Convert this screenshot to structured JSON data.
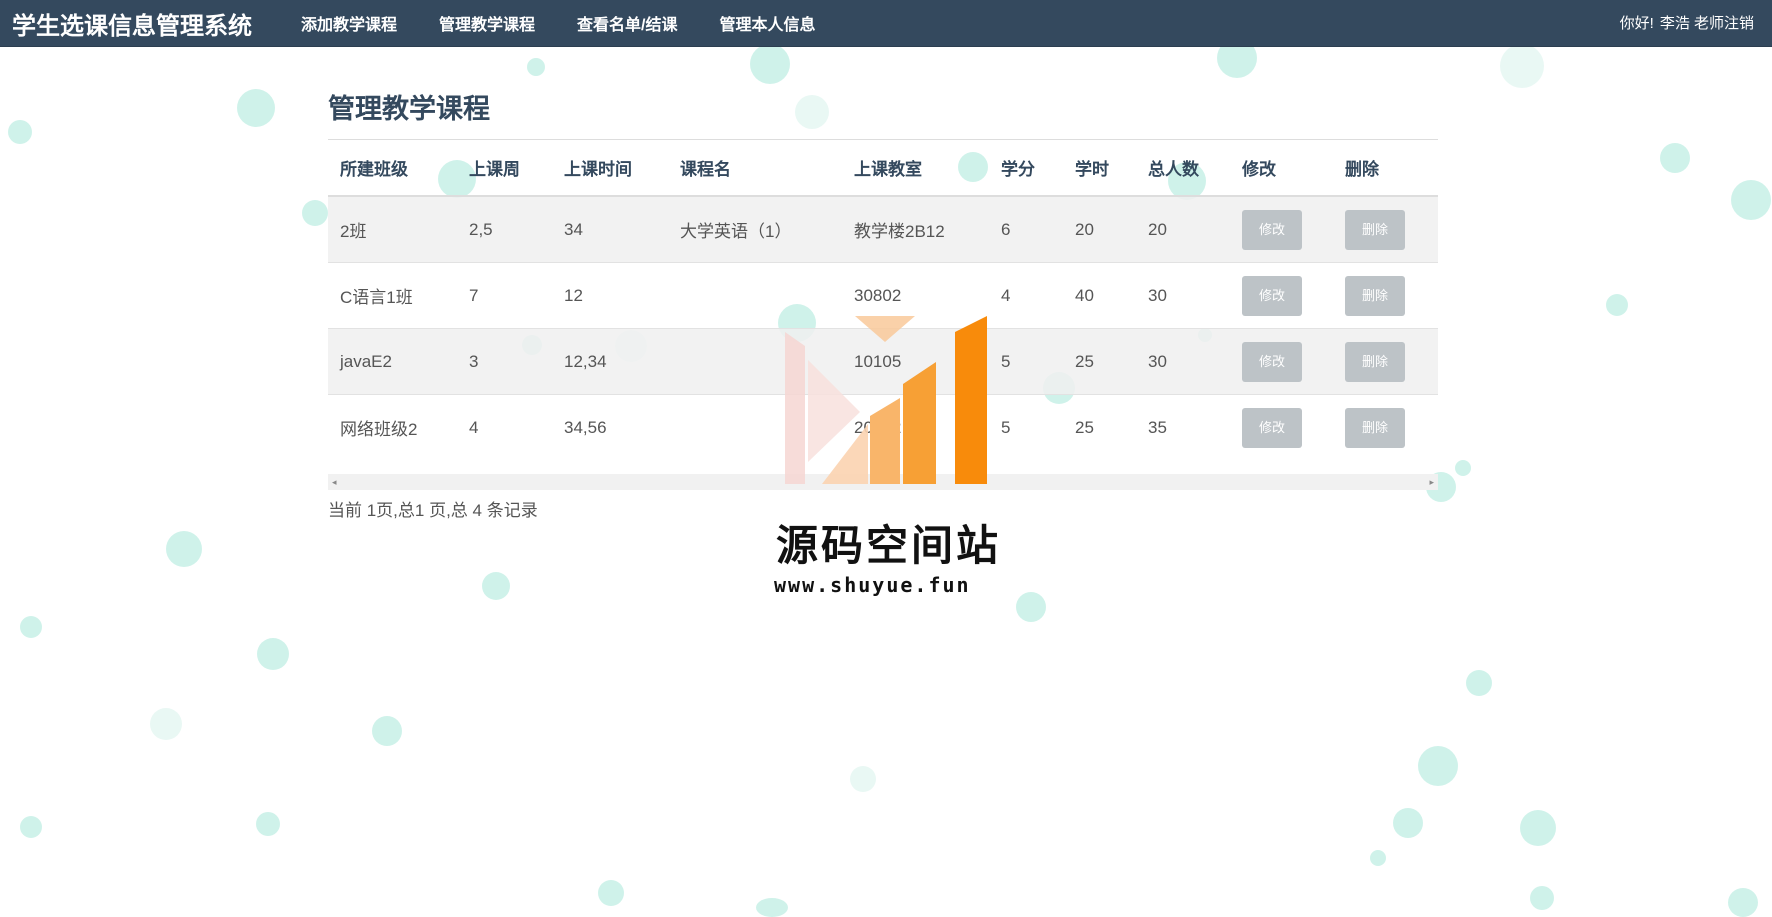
{
  "navbar": {
    "brand": "学生选课信息管理系统",
    "links": [
      "添加教学课程",
      "管理教学课程",
      "查看名单/结课",
      "管理本人信息"
    ],
    "greeting": "你好!",
    "user": "李浩 老师",
    "logout": "注销"
  },
  "page": {
    "title": "管理教学课程"
  },
  "table": {
    "headers": [
      "所建班级",
      "上课周",
      "上课时间",
      "课程名",
      "上课教室",
      "学分",
      "学时",
      "总人数",
      "修改",
      "删除"
    ],
    "rows": [
      [
        "2班",
        "2,5",
        "34",
        "大学英语（1）",
        "教学楼2B12",
        "6",
        "20",
        "20"
      ],
      [
        "C语言1班",
        "7",
        "12",
        "",
        "30802",
        "4",
        "40",
        "30"
      ],
      [
        "javaE2",
        "3",
        "12,34",
        "",
        "10105",
        "5",
        "25",
        "30"
      ],
      [
        "网络班级2",
        "4",
        "34,56",
        "",
        "20202",
        "5",
        "25",
        "35"
      ]
    ],
    "edit_label": "修改",
    "delete_label": "删除"
  },
  "scrollbar": {
    "left_arrow": "◂",
    "right_arrow": "▸"
  },
  "pager": {
    "text": "当前 1页,总1 页,总 4 条记录"
  },
  "watermark": {
    "name": "源码空间站",
    "url": "www.shuyue.fun"
  },
  "colors": {
    "navbar": "#34495e",
    "button": "#bdc3c7",
    "bubble": "#bfeee3",
    "logo_orange": "#f88b0b"
  }
}
